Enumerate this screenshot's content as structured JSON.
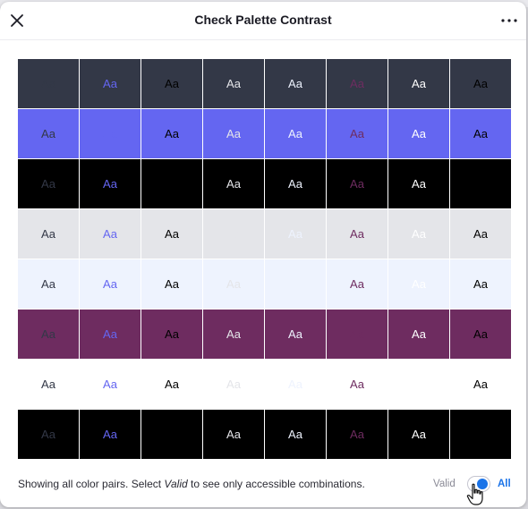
{
  "dialog": {
    "title": "Check Palette Contrast"
  },
  "icons": {
    "close": "close-icon",
    "more": "more-horizontal-icon",
    "cursor": "hand-pointer-icon"
  },
  "palette": [
    "#333847",
    "#6466F1",
    "#000000",
    "#E4E5E9",
    "#EEF3FE",
    "#6E2C60",
    "#FFFFFF",
    "#000000"
  ],
  "sample_text": "Aa",
  "footer": {
    "text_before": "Showing all color pairs. Select ",
    "text_emphasis": "Valid",
    "text_after": " to see only accessible combinations.",
    "toggle_label_off": "Valid",
    "toggle_label_on": "All",
    "toggle_state": "All"
  },
  "colors": {
    "accent": "#1a73e8",
    "title_text": "#1b1b24",
    "muted_text": "#8a8a96"
  }
}
